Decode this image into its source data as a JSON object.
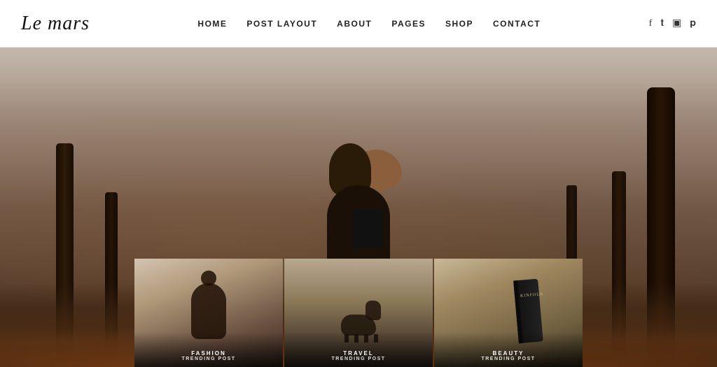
{
  "header": {
    "logo": "Le mars",
    "nav": {
      "items": [
        {
          "label": "HOME",
          "id": "home"
        },
        {
          "label": "POST LAYOUT",
          "id": "post-layout"
        },
        {
          "label": "ABOUT",
          "id": "about"
        },
        {
          "label": "PAGES",
          "id": "pages"
        },
        {
          "label": "SHOP",
          "id": "shop"
        },
        {
          "label": "CONTACT",
          "id": "contact"
        }
      ]
    },
    "social": [
      {
        "icon": "f",
        "name": "facebook-icon",
        "symbol": "f"
      },
      {
        "icon": "t",
        "name": "twitter-icon",
        "symbol": "𝕥"
      },
      {
        "icon": "i",
        "name": "instagram-icon",
        "symbol": "◻"
      },
      {
        "icon": "p",
        "name": "pinterest-icon",
        "symbol": "𝕡"
      }
    ]
  },
  "hero": {
    "alt": "Person sitting in misty forest"
  },
  "cards": [
    {
      "id": "card-fashion",
      "category": "FASHION",
      "label": "TRENDING POST"
    },
    {
      "id": "card-travel",
      "category": "TRAVEL",
      "label": "TRENDING POST"
    },
    {
      "id": "card-beauty",
      "category": "BEAUTY",
      "label": "TRENDING POST"
    }
  ]
}
